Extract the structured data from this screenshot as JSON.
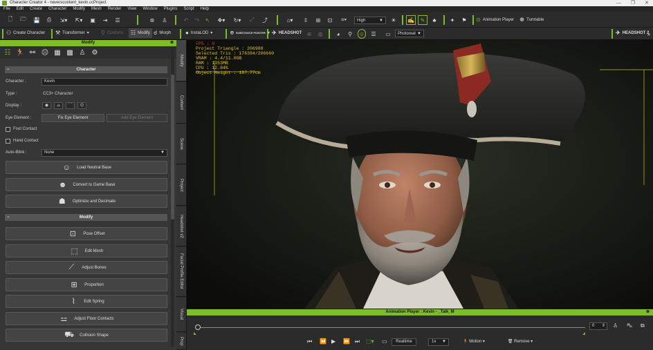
{
  "window": {
    "title": "Character Creator 4 - neverscontent_kevin.ccProject",
    "controls": [
      "—",
      "❐",
      "✕"
    ]
  },
  "menu": [
    "File",
    "Edit",
    "Create",
    "Character",
    "Modify",
    "Mesh",
    "Render",
    "View",
    "Window",
    "Plugins",
    "Script",
    "Help"
  ],
  "toolbar1": {
    "quality": "High",
    "animation_player": "Animation Player",
    "turntable": "Turntable"
  },
  "toolbar2": {
    "create_character": "Create Character",
    "transformer": "Transformer",
    "conform": "Conform",
    "modify": "Modify",
    "morph": "Morph",
    "insta_lod": "InstaLOD",
    "substance": "SUBSTANCE PAINTER",
    "headshot": "HEADSHOT",
    "render_mode": "Photoreal",
    "headshot2": "HEADSHOT 2"
  },
  "panel": {
    "title": "Modify",
    "character_section": "Character",
    "character_label": "Character :",
    "character_value": "Kevin",
    "type_label": "Type :",
    "type_value": "CC3+ Character",
    "display_label": "Display :",
    "eye_label": "Eye Element :",
    "fix_eye": "Fix Eye Element",
    "add_eye": "Add Eye Element",
    "foot_contact": "Foot Contact",
    "hand_contact": "Hand Contact",
    "auto_blink_label": "Auto-Blink :",
    "auto_blink_value": "None",
    "character_buttons": [
      {
        "label": "Load Neutral Base"
      },
      {
        "label": "Convert to Game Base"
      },
      {
        "label": "Optimize and Decimate"
      }
    ],
    "modify_section": "Modify",
    "modify_buttons": [
      {
        "label": "Pose Offset"
      },
      {
        "label": "Edit Mesh"
      },
      {
        "label": "Adjust Bones"
      },
      {
        "label": "Proportion"
      },
      {
        "label": "Edit Spring"
      },
      {
        "label": "Adjust Floor Contacts"
      },
      {
        "label": "Collision Shape"
      }
    ]
  },
  "side_tabs": [
    "Modify",
    "Content",
    "Scene",
    "Project",
    "Headshot v2",
    "Facial Profile Editor",
    "Visual",
    "Prop"
  ],
  "viewport_stats": {
    "fps": "FPS : 0",
    "triangles": "Project Triangle : 206980",
    "selected": "Selected Tris : 176394/206660",
    "vram": "VRAM : 4.4/11.0GB",
    "ram": "RAM : 1353MB",
    "cpu": "CPU : 12.84%",
    "height": "Object Height : 187.77cm"
  },
  "animation": {
    "title": "Animation Player : Kevin - _Talk_M",
    "frame": "0",
    "realtime": "Realtime",
    "speed": "1x",
    "motion": "Motion",
    "remove": "Remove"
  },
  "colors": {
    "accent": "#7dbd2c",
    "stats_text": "#e6c322",
    "fps_text": "#e0392b"
  }
}
